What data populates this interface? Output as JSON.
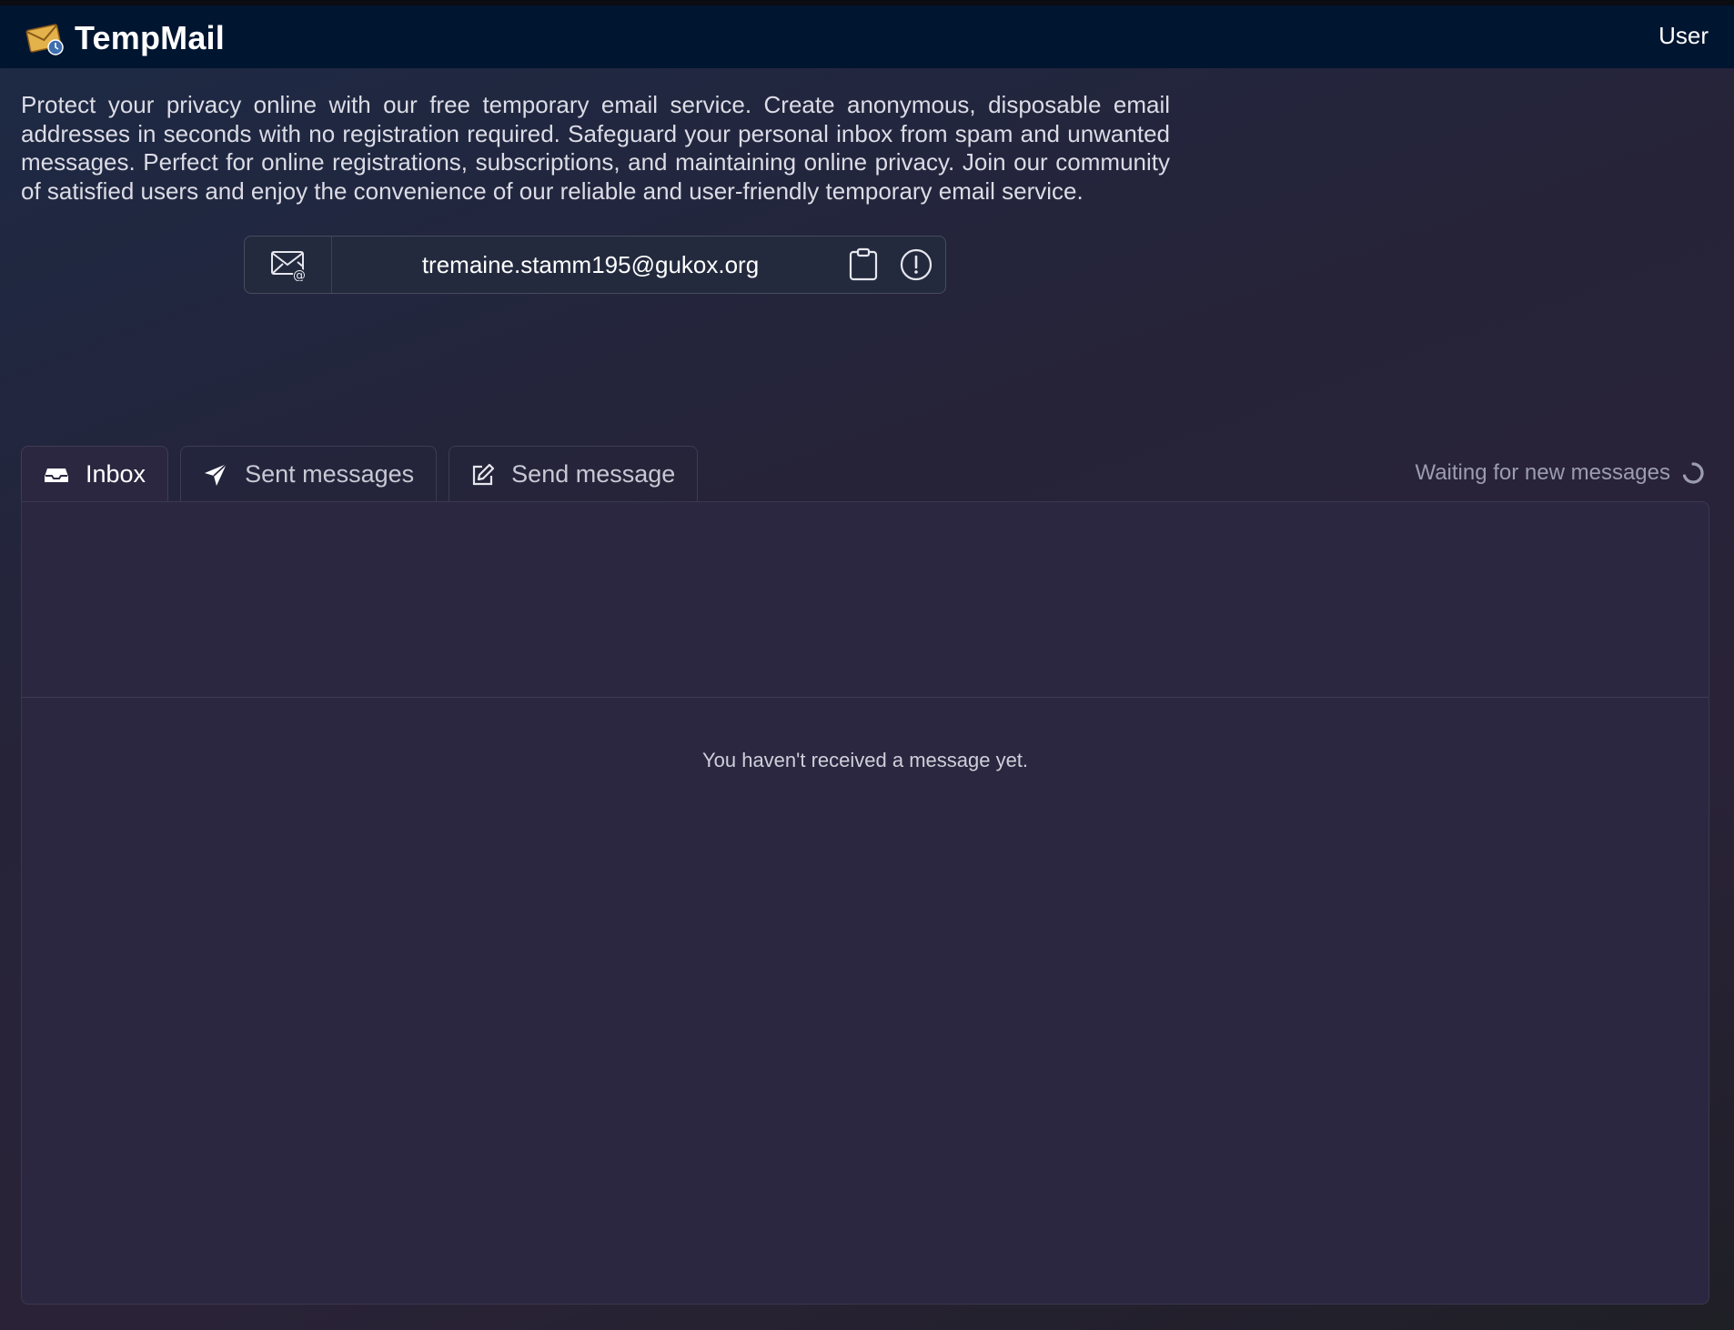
{
  "header": {
    "brand": "TempMail",
    "user_label": "User"
  },
  "intro": {
    "text": "Protect your privacy online with our free temporary email service. Create anonymous, disposable email addresses in seconds with no registration required. Safeguard your personal inbox from spam and unwanted messages. Perfect for online registrations, subscriptions, and maintaining online privacy. Join our community of satisfied users and enjoy the convenience of our reliable and user-friendly temporary email service."
  },
  "email": {
    "address": "tremaine.stamm195@gukox.org"
  },
  "tabs": [
    {
      "label": "Inbox",
      "icon": "inbox-icon",
      "active": true
    },
    {
      "label": "Sent messages",
      "icon": "send-icon",
      "active": false
    },
    {
      "label": "Send message",
      "icon": "compose-icon",
      "active": false
    }
  ],
  "status": {
    "text": "Waiting for new messages"
  },
  "inbox": {
    "empty_text": "You haven't received a message yet."
  },
  "colors": {
    "topbar": "#001530",
    "panel": "#2b2740",
    "accent_logo": "#e3b24a"
  }
}
